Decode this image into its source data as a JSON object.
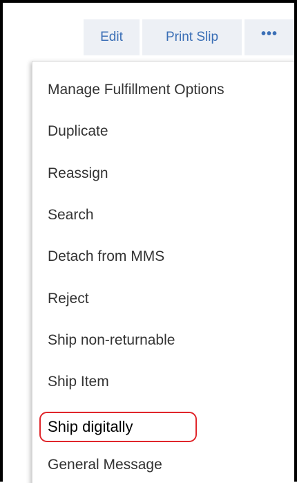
{
  "toolbar": {
    "edit_label": "Edit",
    "print_slip_label": "Print Slip",
    "more_label": "•••"
  },
  "menu": {
    "items": [
      {
        "label": "Manage Fulfillment Options"
      },
      {
        "label": "Duplicate"
      },
      {
        "label": "Reassign"
      },
      {
        "label": "Search"
      },
      {
        "label": "Detach from MMS"
      },
      {
        "label": "Reject"
      },
      {
        "label": "Ship non-returnable"
      },
      {
        "label": "Ship Item"
      },
      {
        "label": "Ship digitally",
        "highlighted": true
      },
      {
        "label": "General Message"
      }
    ]
  },
  "colors": {
    "button_bg": "#edf0f5",
    "button_text": "#3b6fb6",
    "menu_text": "#333333",
    "highlight_outline": "#e0262b"
  }
}
